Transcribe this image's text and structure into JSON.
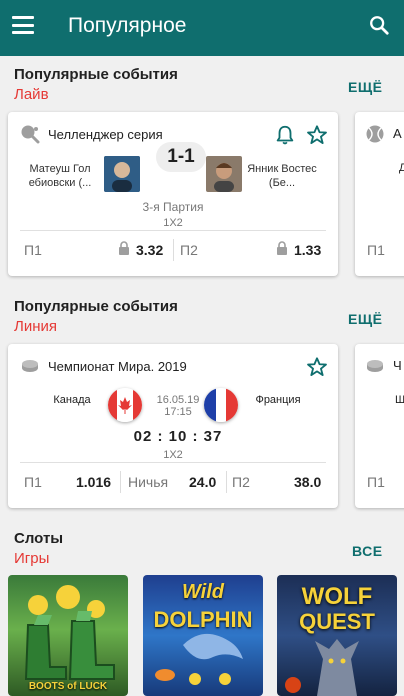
{
  "appbar": {
    "title": "Популярное",
    "menu_icon": "menu-icon",
    "search_icon": "search-icon",
    "color": "#0f6e6e"
  },
  "live_section": {
    "title": "Популярные события",
    "subtitle": "Лайв",
    "more": "ЕЩЁ",
    "card": {
      "league": "Челленджер серия",
      "player1": "Матеуш Гол ебиовски (...",
      "player2": "Янник Востес (Бе...",
      "score": "1-1",
      "set_info": "3-я  Партия",
      "market": "1X2",
      "odds": [
        {
          "label": "П1",
          "value": "3.32",
          "locked": true
        },
        {
          "label": "П2",
          "value": "1.33",
          "locked": true
        }
      ]
    },
    "peek": {
      "league": "А",
      "name": "Д",
      "odd_label": "П1"
    }
  },
  "line_section": {
    "title": "Популярные события",
    "subtitle": "Линия",
    "more": "ЕЩЁ",
    "card": {
      "league": "Чемпионат Мира. 2019",
      "team1": "Канада",
      "team2": "Франция",
      "date": "16.05.19",
      "time": "17:15",
      "countdown": "02 : 10 : 37",
      "market": "1X2",
      "odds": [
        {
          "label": "П1",
          "value": "1.016"
        },
        {
          "label": "Ничья",
          "value": "24.0"
        },
        {
          "label": "П2",
          "value": "38.0"
        }
      ]
    },
    "peek": {
      "league": "Ч",
      "name": "Ш",
      "odd_label": "П1"
    }
  },
  "slots_section": {
    "title": "Слоты",
    "subtitle": "Игры",
    "more": "ВСЕ",
    "games": [
      {
        "name": "Boots of Luck",
        "label": "BOOTS of LUCK"
      },
      {
        "name": "Wild Dolphin",
        "label_top": "Wild",
        "label_bottom": "DOLPHIN"
      },
      {
        "name": "Wolf Quest",
        "label_top": "WOLF",
        "label_bottom": "QUEST"
      }
    ]
  },
  "colors": {
    "accent": "#0f6e6e",
    "subtitle": "#e53935"
  }
}
